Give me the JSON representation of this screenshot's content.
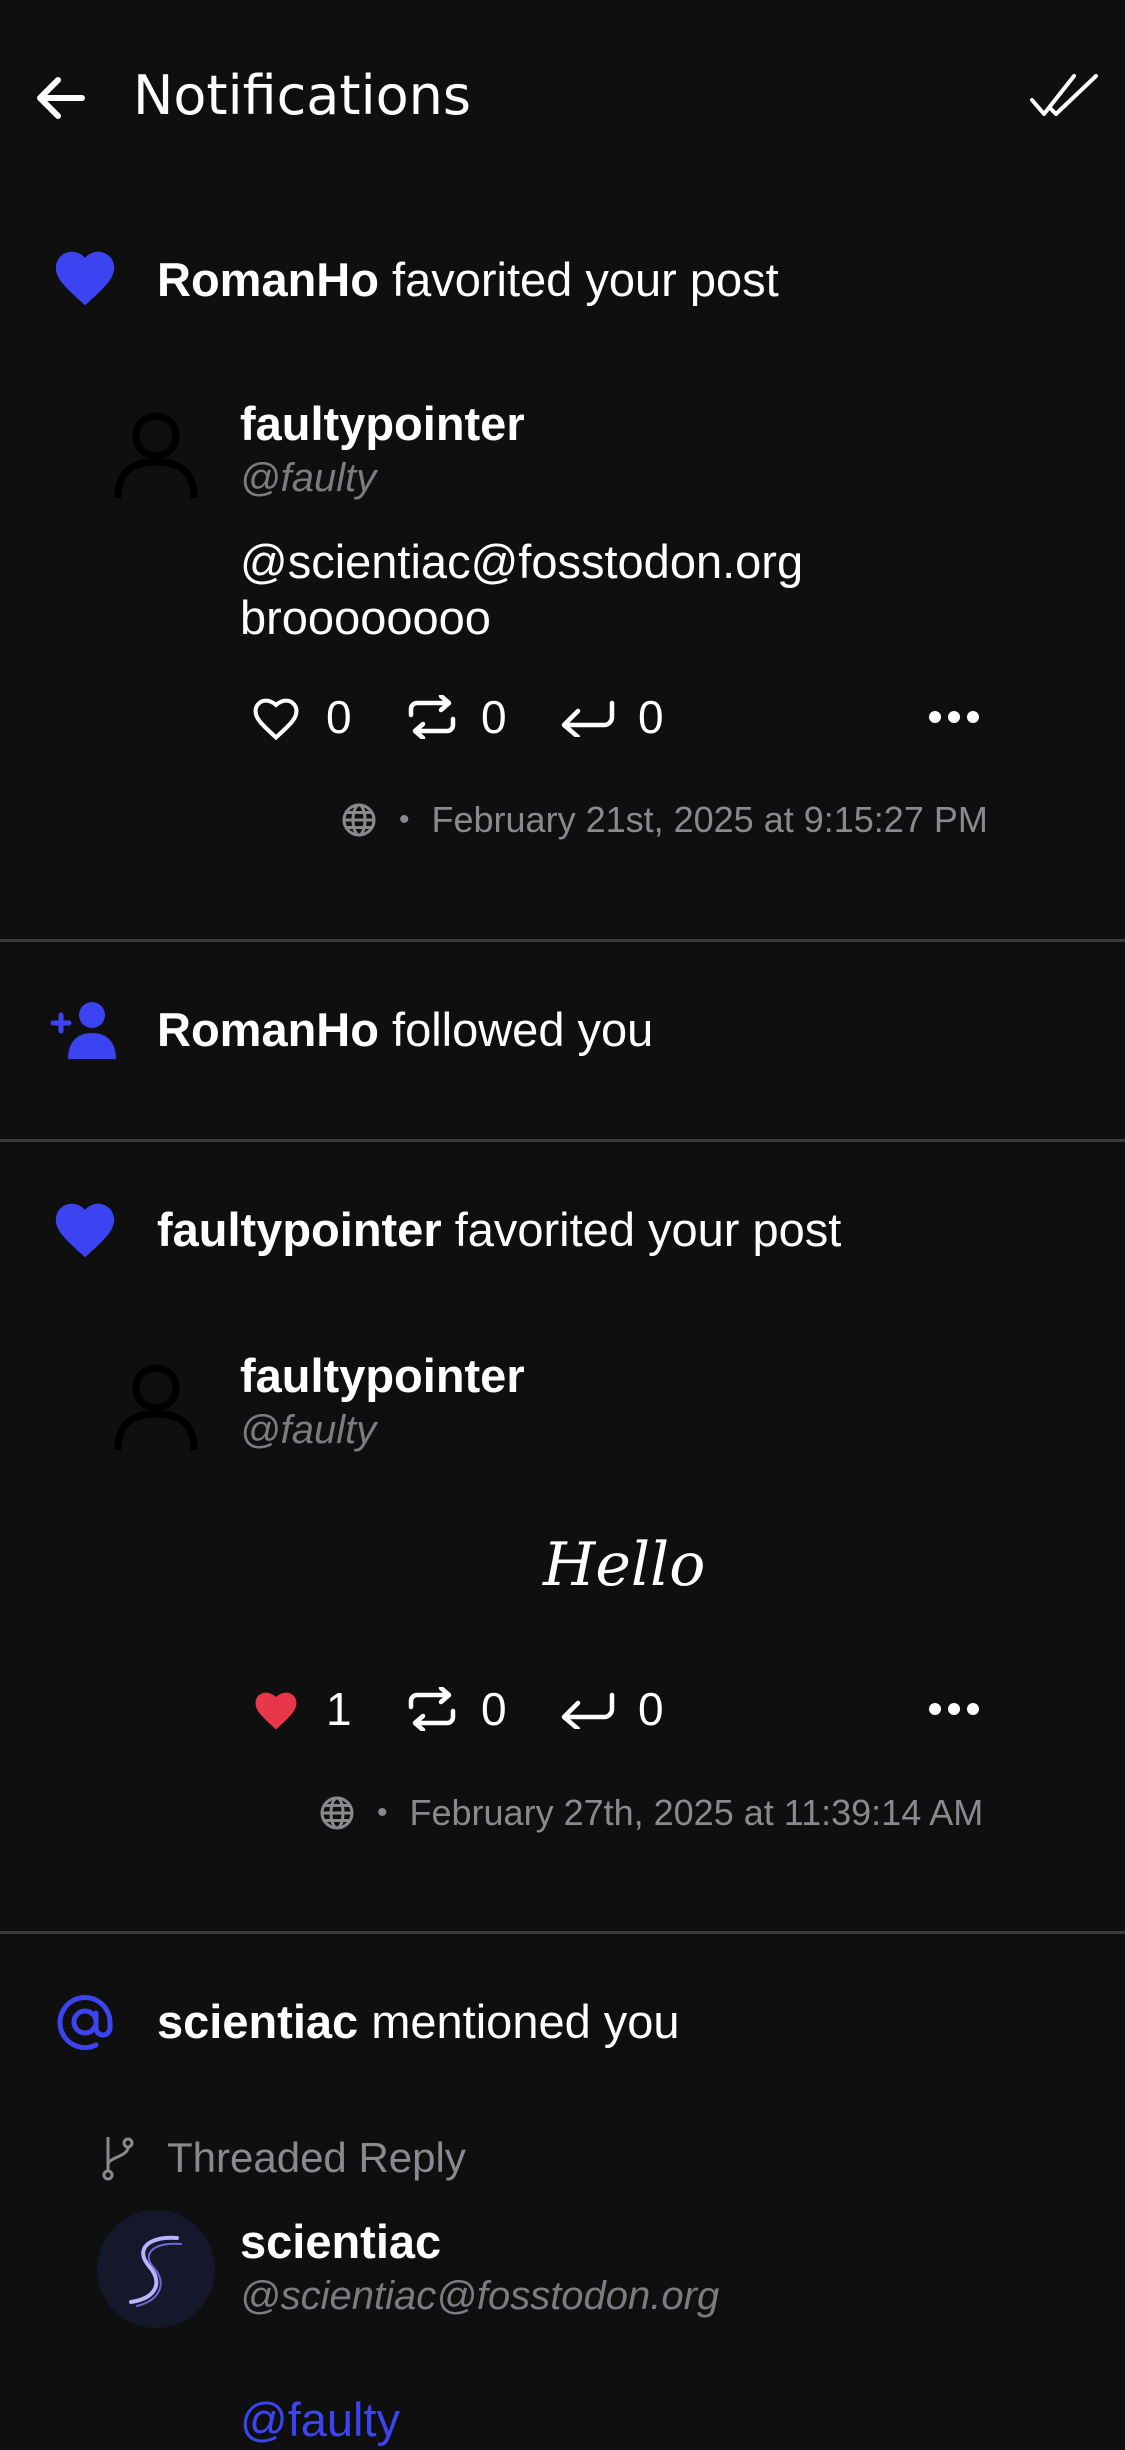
{
  "header": {
    "title": "Notifications"
  },
  "notifications": [
    {
      "actor": "RomanHo",
      "action": "favorited your post",
      "post": {
        "author_name": "faultypointer",
        "author_handle": "@faulty",
        "body_line1": "@scientiac@fosstodon.org",
        "body_line2": "broooooooo",
        "likes": "0",
        "boosts": "0",
        "replies": "0",
        "timestamp": "February 21st, 2025 at 9:15:27 PM"
      }
    },
    {
      "actor": "RomanHo",
      "action": "followed you"
    },
    {
      "actor": "faultypointer",
      "action": "favorited your post",
      "post": {
        "author_name": "faultypointer",
        "author_handle": "@faulty",
        "body": "Hello",
        "likes": "1",
        "boosts": "0",
        "replies": "0",
        "timestamp": "February 27th, 2025 at 11:39:14 AM"
      }
    },
    {
      "actor": "scientiac",
      "action": "mentioned you",
      "thread_label": "Threaded Reply",
      "post": {
        "author_name": "scientiac",
        "author_handle": "@scientiac@fosstodon.org",
        "body_mention": "@faulty"
      }
    }
  ],
  "colors": {
    "background": "#0f0f10",
    "accent": "#3b44f0",
    "liked": "#e8364a",
    "muted": "#8a8a8e"
  },
  "icons": {
    "back": "arrow-left-icon",
    "mark_all_read": "double-check-icon",
    "favorite": "heart-icon",
    "follow": "person-add-icon",
    "mention": "at-icon",
    "boost": "repeat-icon",
    "reply": "reply-icon",
    "more": "more-horizontal-icon",
    "visibility": "globe-icon",
    "thread": "branch-icon"
  }
}
